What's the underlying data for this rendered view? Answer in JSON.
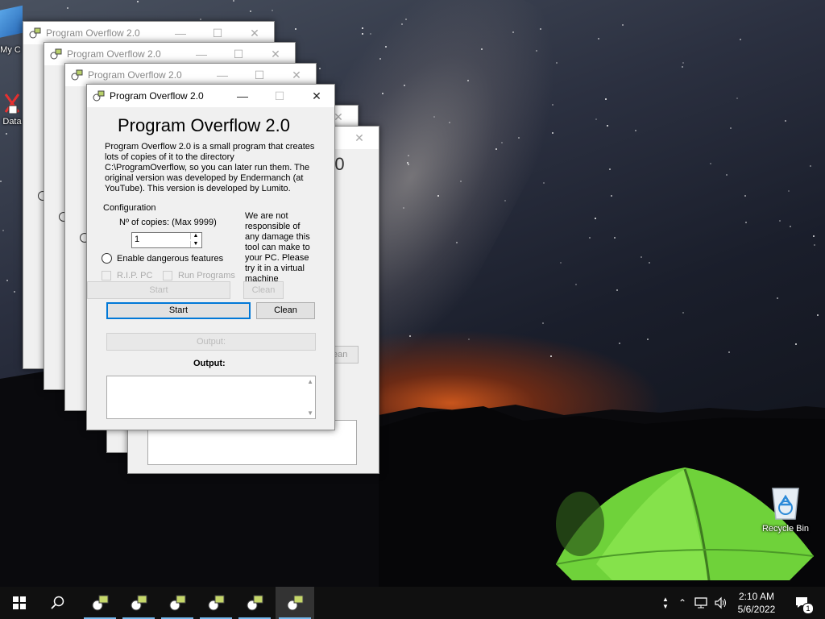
{
  "desktop": {
    "icons": [
      {
        "id": "my-computer",
        "label": "My C"
      },
      {
        "id": "data",
        "label": "Data"
      },
      {
        "id": "recycle-bin",
        "label": "Recycle Bin"
      }
    ]
  },
  "app": {
    "window_title": "Program Overflow 2.0",
    "heading": "Program Overflow 2.0",
    "heading_partial": "2.0",
    "description": "Program Overflow 2.0 is a small program that creates lots of copies of it to the directory C:\\ProgramOverflow, so you can later run them. The original version was developed by Endermanch (at YouTube). This version is developed by Lumito.",
    "warning": "We are not responsible of any damage this tool can make to your PC. Please try it in a virtual machine",
    "configuration_label": "Configuration",
    "copies_label": "Nº of copies: (Max 9999)",
    "copies_value": "1",
    "dangerous_label": "Enable dangerous features",
    "rip_pc_label": "R.I.P. PC",
    "run_programs_label": "Run Programs",
    "start_label": "Start",
    "clean_label": "Clean",
    "output_label": "Output:",
    "output_label_ghost": "Output:",
    "ghost_dangerous": "Enable dangerous feature",
    "ghost_start": "Start",
    "ghost_clean": "Clean"
  },
  "taskbar": {
    "time": "2:10 AM",
    "date": "5/6/2022",
    "notification_count": "1",
    "app_count": 6
  }
}
